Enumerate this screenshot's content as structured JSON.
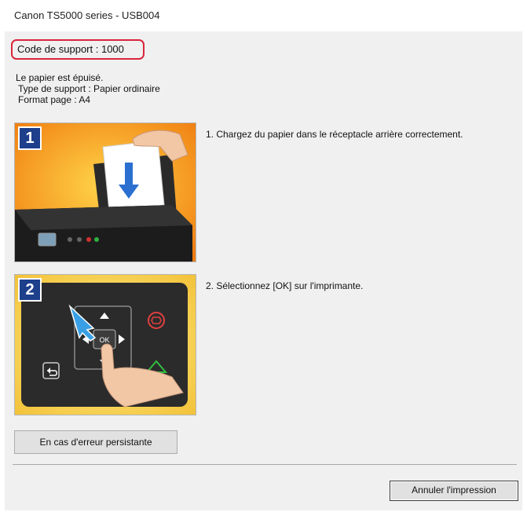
{
  "window": {
    "title": "Canon TS5000 series - USB004"
  },
  "support_code": "Code de support : 1000",
  "message": {
    "line1": "Le papier est épuisé.",
    "line2": "Type de support : Papier ordinaire",
    "line3": "Format page : A4"
  },
  "steps": [
    {
      "number": "1",
      "text": "1.  Chargez du papier dans le réceptacle arrière correctement."
    },
    {
      "number": "2",
      "text": "2.  Sélectionnez [OK] sur l'imprimante."
    }
  ],
  "buttons": {
    "persistent_error": "En cas d'erreur persistante",
    "cancel_print": "Annuler l'impression"
  },
  "illustration_labels": {
    "ok_key": "OK"
  },
  "colors": {
    "highlight_border": "#d9263b",
    "step_badge": "#1d3f8c"
  },
  "icons": [
    "paper-insert-arrow-icon",
    "printer-icon",
    "ok-button-icon",
    "stop-icon",
    "start-icon",
    "back-icon",
    "pointing-hand-icon"
  ]
}
